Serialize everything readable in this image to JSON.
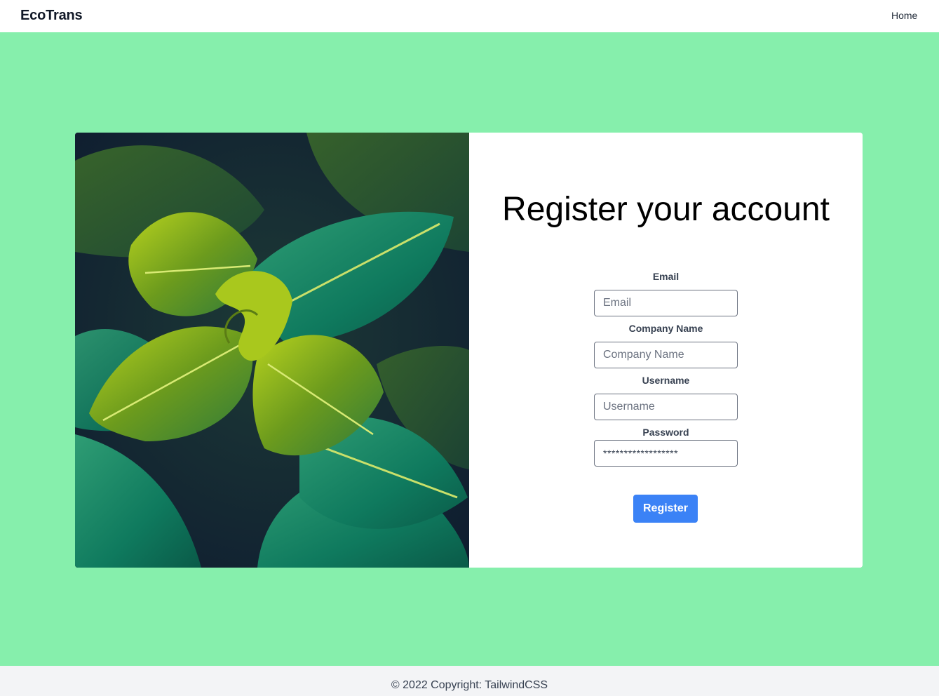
{
  "navbar": {
    "brand": "EcoTrans",
    "links": [
      {
        "label": "Home"
      }
    ]
  },
  "hero": {
    "image": "green-leaf-plant-photo"
  },
  "form": {
    "title": "Register your account",
    "fields": [
      {
        "label": "Email",
        "placeholder": "Email",
        "value": ""
      },
      {
        "label": "Company Name",
        "placeholder": "Company Name",
        "value": ""
      },
      {
        "label": "Username",
        "placeholder": "Username",
        "value": ""
      },
      {
        "label": "Password",
        "placeholder": "",
        "value": "******************"
      }
    ],
    "submit_label": "Register"
  },
  "footer": {
    "text": "© 2022 Copyright: TailwindCSS"
  },
  "colors": {
    "page_background": "#86efac",
    "primary_button": "#3b82f6",
    "footer_background": "#f3f4f6"
  }
}
